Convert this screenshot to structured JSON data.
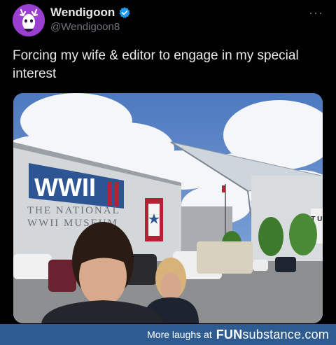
{
  "tweet": {
    "display_name": "Wendigoon",
    "handle": "@Wendigoon8",
    "more_label": "···",
    "text": "Forcing my wife & editor to engage in my special interest"
  },
  "photo": {
    "banner_logo": "WWII",
    "building_line1": "THE NATIONAL",
    "building_line2": "WWII MUSEUM",
    "sign_right": "OT UR"
  },
  "footer": {
    "tagline": "More laughs at",
    "brand_bold": "FUN",
    "brand_light": "substance",
    "brand_suffix": ".com"
  },
  "colors": {
    "background": "#000000",
    "handle_gray": "#71767b",
    "verified_blue": "#1d9bf0",
    "avatar_purple": "#9b3fd3",
    "footer_blue": "#2f5c90"
  },
  "icons": [
    "deer-avatar-icon",
    "verified-badge-icon",
    "more-options-icon"
  ]
}
